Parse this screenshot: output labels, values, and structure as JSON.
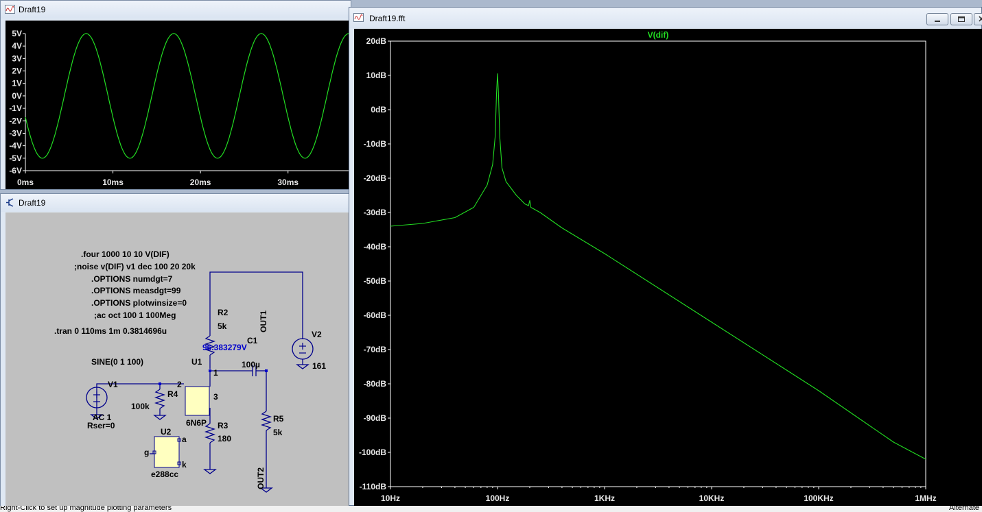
{
  "waveform_window": {
    "title": "Draft19",
    "y_ticks": [
      "5V",
      "4V",
      "3V",
      "2V",
      "1V",
      "0V",
      "-1V",
      "-2V",
      "-3V",
      "-4V",
      "-5V",
      "-6V"
    ],
    "x_ticks": [
      "0ms",
      "10ms",
      "20ms",
      "30ms"
    ]
  },
  "schematic_window": {
    "title": "Draft19",
    "directives": [
      ".four 1000 10 10 V(DIF)",
      ";noise v(DIF) v1 dec 100 20 20k",
      ".OPTIONS numdgt=7",
      ".OPTIONS measdgt=99",
      ".OPTIONS plotwinsize=0",
      ";ac oct 100 1 100Meg",
      ".tran 0 110ms 1m 0.3814696u"
    ],
    "source_label": "SINE(0 1 100)",
    "node_voltage": "96.383279V",
    "components": {
      "r2_name": "R2",
      "r2_value": "5k",
      "r3_name": "R3",
      "r3_value": "180",
      "r4_name": "R4",
      "r4_value": "100k",
      "r5_name": "R5",
      "r5_value": "5k",
      "c1_name": "C1",
      "c1_value": "100µ",
      "u1_name": "U1",
      "u1_part": "6N6P",
      "u1_pin1": "1",
      "u1_pin2": "2",
      "u1_pin3": "3",
      "u2_name": "U2",
      "u2_part": "e288cc",
      "u2_pin_a": "a",
      "u2_pin_g": "g",
      "u2_pin_k": "k",
      "v1_name": "V1",
      "v1_ac": "AC 1",
      "v1_rser": "Rser=0",
      "v2_name": "V2",
      "v2_value": "161",
      "out1": "OUT1",
      "out2": "OUT2"
    }
  },
  "fft_window": {
    "title": "Draft19.fft",
    "trace_name": "V(dif)",
    "trace_color": "#22dd22"
  },
  "status_bar": {
    "left": "Right-Click to set up magnitude plotting parameters",
    "right": "Alternate"
  },
  "chart_data": [
    {
      "type": "line",
      "title": "",
      "xlabel": "",
      "ylabel": "",
      "x_unit": "ms",
      "y_unit": "V",
      "xlim": [
        0,
        37
      ],
      "ylim": [
        -6,
        5
      ],
      "series": [
        {
          "waveform": "sine",
          "amplitude": 5,
          "frequency_hz": 100,
          "phase_deg": 200
        }
      ],
      "x_ticks": [
        0,
        10,
        20,
        30
      ],
      "y_ticks": [
        5,
        4,
        3,
        2,
        1,
        0,
        -1,
        -2,
        -3,
        -4,
        -5,
        -6
      ],
      "grid": false
    },
    {
      "type": "line",
      "title": "V(dif)",
      "xlabel": "",
      "ylabel": "",
      "x_scale": "log",
      "xlim_hz": [
        10,
        1000000
      ],
      "ylim_db": [
        -110,
        20
      ],
      "x_tick_labels": [
        "10Hz",
        "100Hz",
        "1KHz",
        "10KHz",
        "100KHz",
        "1MHz"
      ],
      "y_tick_labels": [
        "20dB",
        "10dB",
        "0dB",
        "-10dB",
        "-20dB",
        "-30dB",
        "-40dB",
        "-50dB",
        "-60dB",
        "-70dB",
        "-80dB",
        "-90dB",
        "-100dB",
        "-110dB"
      ],
      "series": [
        {
          "name": "V(dif)",
          "points_hz_db": [
            [
              10,
              -34
            ],
            [
              20,
              -33.2
            ],
            [
              40,
              -31.5
            ],
            [
              60,
              -28.5
            ],
            [
              80,
              -22
            ],
            [
              90,
              -16
            ],
            [
              95,
              -8
            ],
            [
              98,
              5
            ],
            [
              100,
              10.5
            ],
            [
              102,
              5
            ],
            [
              105,
              -8
            ],
            [
              110,
              -17
            ],
            [
              120,
              -21
            ],
            [
              150,
              -25
            ],
            [
              180,
              -27.5
            ],
            [
              195,
              -28
            ],
            [
              200,
              -26.5
            ],
            [
              205,
              -28.5
            ],
            [
              250,
              -30
            ],
            [
              400,
              -34.5
            ],
            [
              1000,
              -42
            ],
            [
              10000,
              -62
            ],
            [
              100000,
              -82
            ],
            [
              500000,
              -97
            ],
            [
              1000000,
              -102
            ]
          ]
        }
      ],
      "grid": false
    }
  ]
}
